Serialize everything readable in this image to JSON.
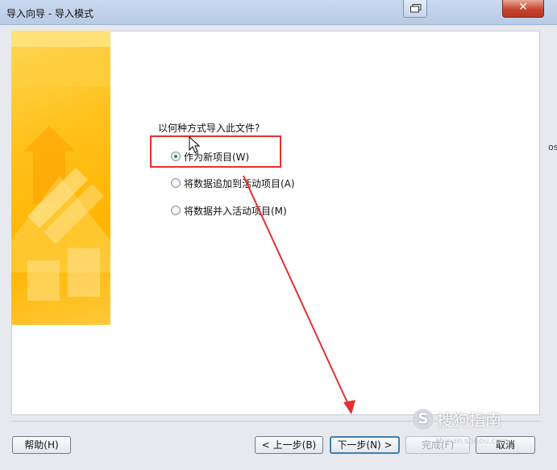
{
  "window": {
    "title": "导入向导 - 导入模式",
    "close_glyph": "✕"
  },
  "prompt": "以何种方式导入此文件?",
  "options": [
    {
      "label": "作为新项目(W)",
      "checked": true
    },
    {
      "label": "将数据追加到活动项目(A)",
      "checked": false
    },
    {
      "label": "将数据并入活动项目(M)",
      "checked": false
    }
  ],
  "buttons": {
    "help": "帮助(H)",
    "back": "< 上一步(B)",
    "next": "下一步(N) >",
    "finish": "完成(F)",
    "cancel": "取消"
  },
  "watermark": {
    "icon": "S",
    "text": "搜狗指南",
    "url": "zhinan.sogou.com"
  },
  "side_text": "os",
  "colors": {
    "annotation_red": "#e53030",
    "banner_yellow": "#ffc21c"
  }
}
